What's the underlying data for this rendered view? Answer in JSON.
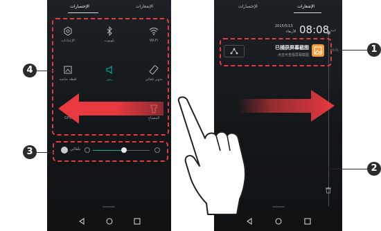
{
  "left_phone": {
    "tabs": {
      "notifications": "الإشعارات",
      "shortcuts": "الإختصارات"
    },
    "toggles": [
      {
        "name": "wifi-icon",
        "label": "Wi-Fi"
      },
      {
        "name": "bluetooth-icon",
        "label": "بلوتوث"
      },
      {
        "name": "settings-icon",
        "label": "الإعدادات"
      },
      {
        "name": "auto-rotate-icon",
        "label": "تدوير تلقائي"
      },
      {
        "name": "sound-icon",
        "label": "رنين"
      },
      {
        "name": "screenshot-icon",
        "label": "لقطة شاشة"
      },
      {
        "name": "flashlight-icon",
        "label": "المصباح"
      },
      {
        "name": "location-icon",
        "label": "GPS"
      }
    ],
    "brightness": {
      "auto_label": "تلقائي",
      "level": 0.55
    }
  },
  "right_phone": {
    "tabs": {
      "notifications": "الإشعارات",
      "shortcuts": "الإختصارات"
    },
    "clock": {
      "time": "08:08",
      "date": "2015/5/13",
      "day": "الأربعاء"
    },
    "side_label": "اليوم",
    "notification": {
      "title": "已捕获屏幕截图",
      "subtitle": "点击可查看屏幕截图",
      "time": "08:08"
    }
  },
  "callouts": {
    "c1": "1",
    "c2": "2",
    "c3": "3",
    "c4": "4"
  },
  "colors": {
    "highlight": "#e7393f",
    "accent": "#00b2a0",
    "notif_icon": "#f39c3b"
  }
}
